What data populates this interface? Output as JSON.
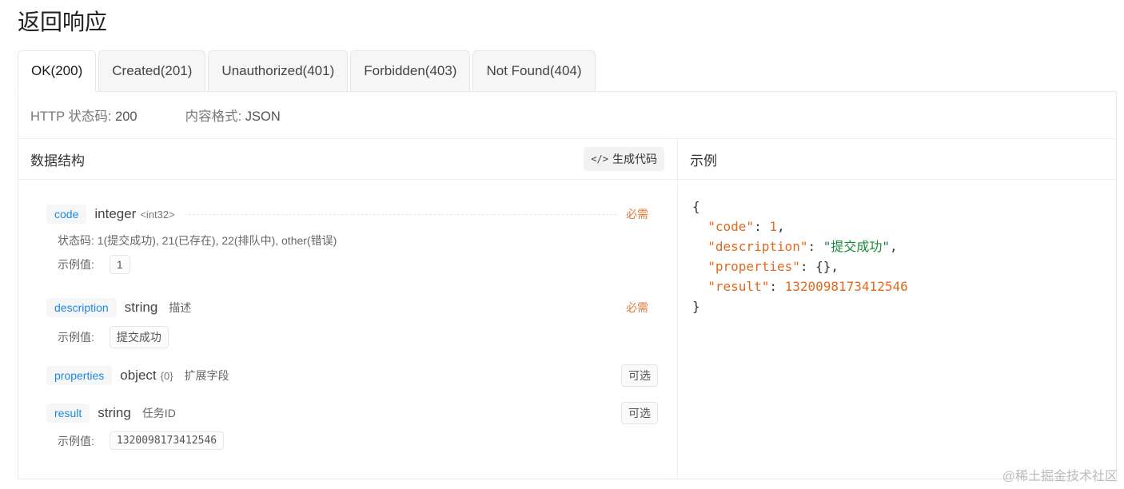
{
  "title": "返回响应",
  "tabs": [
    {
      "label": "OK(200)",
      "active": true
    },
    {
      "label": "Created(201)",
      "active": false
    },
    {
      "label": "Unauthorized(401)",
      "active": false
    },
    {
      "label": "Forbidden(403)",
      "active": false
    },
    {
      "label": "Not Found(404)",
      "active": false
    }
  ],
  "meta": {
    "status_label": "HTTP 状态码:",
    "status_value": "200",
    "format_label": "内容格式:",
    "format_value": "JSON"
  },
  "schema": {
    "heading": "数据结构",
    "gen_code_icon": "</>",
    "gen_code_label": "生成代码",
    "example_label": "示例值:",
    "fields": [
      {
        "name": "code",
        "type": "integer",
        "subtype": "<int32>",
        "desc": "",
        "req": "必需",
        "note": "状态码: 1(提交成功), 21(已存在), 22(排队中), other(错误)",
        "example": "1"
      },
      {
        "name": "description",
        "type": "string",
        "subtype": "",
        "desc": "描述",
        "req": "必需",
        "note": "",
        "example": "提交成功"
      },
      {
        "name": "properties",
        "type": "object",
        "subtype": "{0}",
        "desc": "扩展字段",
        "req": "可选",
        "note": "",
        "example": ""
      },
      {
        "name": "result",
        "type": "string",
        "subtype": "",
        "desc": "任务ID",
        "req": "可选",
        "note": "",
        "example": "1320098173412546"
      }
    ]
  },
  "example_panel": {
    "heading": "示例",
    "json": {
      "open": "{",
      "code_key": "\"code\"",
      "code_val": "1",
      "desc_key": "\"description\"",
      "desc_val": "\"提交成功\"",
      "props_key": "\"properties\"",
      "props_val": "{}",
      "result_key": "\"result\"",
      "result_val": "1320098173412546",
      "close": "}"
    }
  },
  "watermark": "@稀土掘金技术社区"
}
